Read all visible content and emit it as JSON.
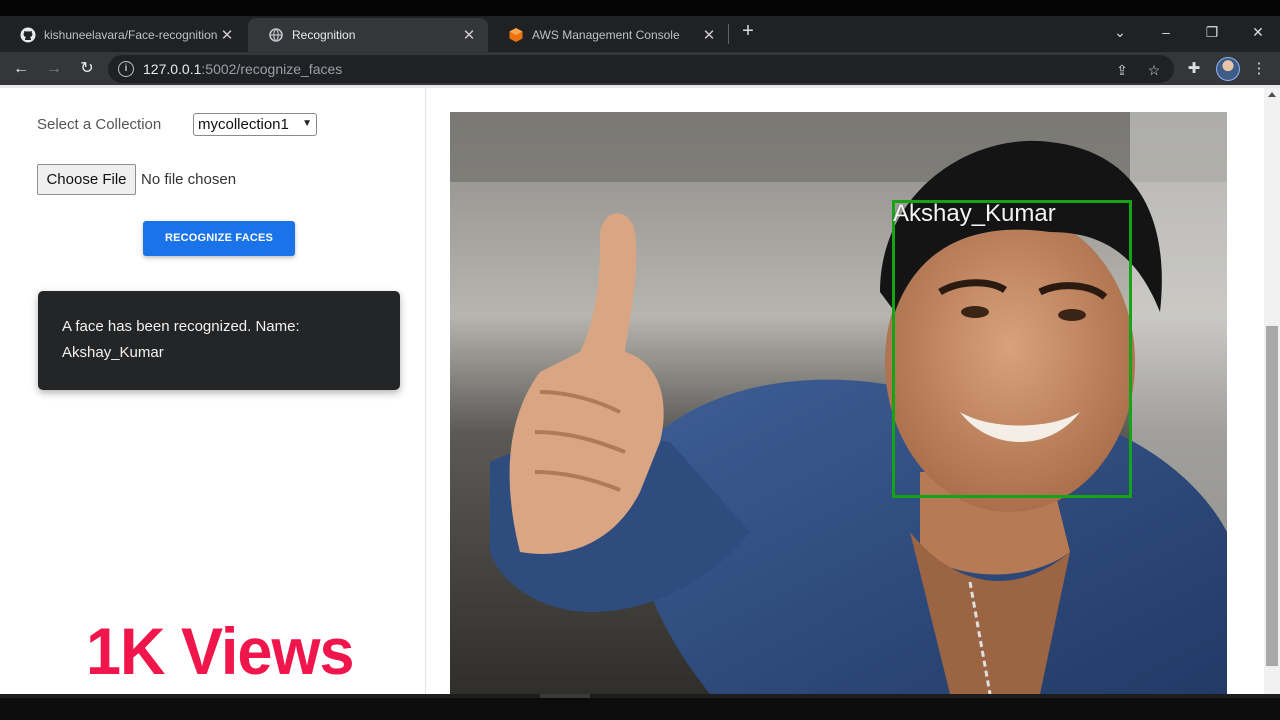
{
  "browser": {
    "tabs": [
      {
        "title": "kishuneelavara/Face-recognition",
        "icon": "github-icon",
        "active": false
      },
      {
        "title": "Recognition",
        "icon": "globe-icon",
        "active": true
      },
      {
        "title": "AWS Management Console",
        "icon": "aws-cube-icon",
        "active": false
      }
    ],
    "url_host": "127.0.0.1",
    "url_rest": ":5002/recognize_faces"
  },
  "form": {
    "select_label": "Select a Collection",
    "select_value": "mycollection1",
    "file_button": "Choose File",
    "file_status": "No file chosen",
    "submit_label": "RECOGNIZE FACES"
  },
  "result": {
    "message_line1": "A face has been recognized. Name:",
    "message_line2": "Akshay_Kumar"
  },
  "detection": {
    "label": "Akshay_Kumar",
    "box_color": "#17a317"
  },
  "overlay": {
    "views_text": "1K Views",
    "color": "#f0154a"
  },
  "colors": {
    "button_blue": "#1a73e8",
    "card_dark": "#242526"
  }
}
